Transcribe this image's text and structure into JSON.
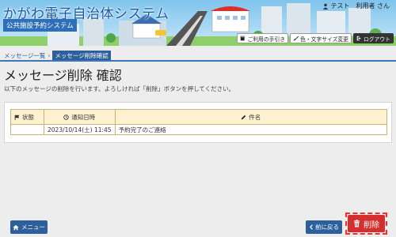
{
  "header": {
    "title": "かがわ電子自治体システム",
    "subtitle": "公共施設予約システム",
    "user": "テスト　利用者 さん",
    "buttons": {
      "help": "ご利用の手引き",
      "display": "色・文字サイズ変更",
      "logout": "ログアウト"
    }
  },
  "breadcrumb": {
    "parent": "メッセージ一覧",
    "separator": "›",
    "current": "メッセージ削除確認"
  },
  "page": {
    "title": "メッセージ削除 確認",
    "description": "以下のメッセージの削除を行います。よろしければ「削除」ボタンを押してください。"
  },
  "table": {
    "headers": {
      "status": "状態",
      "date": "通知日時",
      "subject": "件名"
    },
    "rows": [
      {
        "status": "",
        "date": "2023/10/14(土) 11:45",
        "subject": "予約完了のご連絡"
      }
    ]
  },
  "footer": {
    "menu": "メニュー",
    "back": "前に戻る",
    "delete": "削除"
  },
  "colors": {
    "primary": "#2d5f9a",
    "danger": "#d32f2f",
    "table_header": "#fdf1d0"
  }
}
